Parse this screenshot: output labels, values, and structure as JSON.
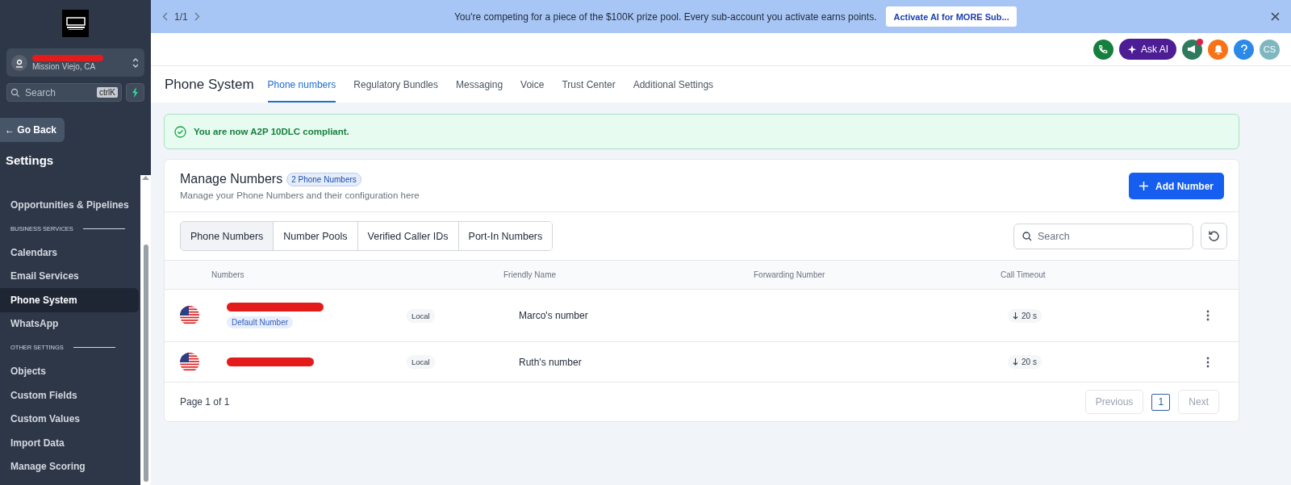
{
  "sidebar": {
    "account": {
      "location": "Mission Viejo, CA"
    },
    "search": {
      "placeholder": "Search",
      "shortcut": "ctrlK"
    },
    "back_button": "← Go Back",
    "title": "Settings",
    "items": [
      {
        "kind": "link",
        "label": "Opportunities & Pipelines",
        "selected": false
      },
      {
        "kind": "section",
        "label": "BUSINESS SERVICES"
      },
      {
        "kind": "link",
        "label": "Calendars",
        "selected": false
      },
      {
        "kind": "link",
        "label": "Email Services",
        "selected": false
      },
      {
        "kind": "link",
        "label": "Phone System",
        "selected": true
      },
      {
        "kind": "link",
        "label": "WhatsApp",
        "selected": false
      },
      {
        "kind": "section",
        "label": "OTHER SETTINGS"
      },
      {
        "kind": "link",
        "label": "Objects",
        "selected": false
      },
      {
        "kind": "link",
        "label": "Custom Fields",
        "selected": false
      },
      {
        "kind": "link",
        "label": "Custom Values",
        "selected": false
      },
      {
        "kind": "link",
        "label": "Import Data",
        "selected": false
      },
      {
        "kind": "link",
        "label": "Manage Scoring",
        "selected": false
      }
    ]
  },
  "banner": {
    "pager": "1/1",
    "message": "You're competing for a piece of the $100K prize pool. Every sub-account you activate earns points.",
    "action": "Activate AI for MORE Sub..."
  },
  "header": {
    "ask_ai": "Ask AI",
    "avatar": "CS"
  },
  "page": {
    "title": "Phone System",
    "tabs": [
      {
        "label": "Phone numbers",
        "selected": true
      },
      {
        "label": "Regulatory Bundles",
        "selected": false
      },
      {
        "label": "Messaging",
        "selected": false
      },
      {
        "label": "Voice",
        "selected": false
      },
      {
        "label": "Trust Center",
        "selected": false
      },
      {
        "label": "Additional Settings",
        "selected": false
      }
    ]
  },
  "alert": {
    "message": "You are now A2P 10DLC compliant."
  },
  "card": {
    "title": "Manage Numbers",
    "count_badge": "2 Phone Numbers",
    "subtitle": "Manage your Phone Numbers and their configuration here",
    "add_button": "Add Number",
    "segments": [
      {
        "label": "Phone Numbers",
        "selected": true
      },
      {
        "label": "Number Pools",
        "selected": false
      },
      {
        "label": "Verified Caller IDs",
        "selected": false
      },
      {
        "label": "Port-In Numbers",
        "selected": false
      }
    ],
    "search": {
      "placeholder": "Search"
    },
    "table": {
      "columns": [
        "Numbers",
        "Friendly Name",
        "Forwarding Number",
        "Call Timeout"
      ],
      "rows": [
        {
          "default_badge": "Default Number",
          "type": "Local",
          "friendly_name": "Marco's number",
          "timeout": "20 s"
        },
        {
          "type": "Local",
          "friendly_name": "Ruth's number",
          "timeout": "20 s"
        }
      ]
    },
    "footer": {
      "page_info": "Page 1 of 1",
      "previous": "Previous",
      "page": "1",
      "next": "Next"
    }
  }
}
